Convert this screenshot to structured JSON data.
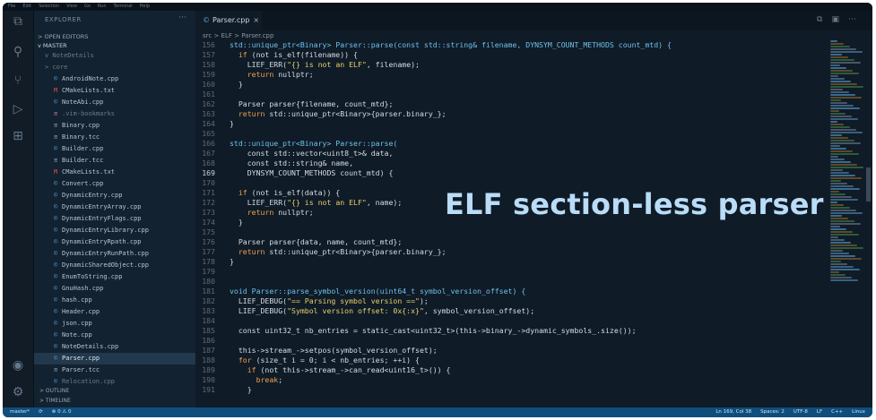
{
  "menubar": [
    "File",
    "Edit",
    "Selection",
    "View",
    "Go",
    "Run",
    "Terminal",
    "Help"
  ],
  "sidebar": {
    "title": "EXPLORER",
    "more": "···",
    "open_editors": "> OPEN EDITORS",
    "master": "v MASTER",
    "items": [
      {
        "label": "v NoteDetails",
        "icon": "folder",
        "dim": true
      },
      {
        "label": "> core",
        "icon": "folder",
        "dim": true
      },
      {
        "label": "AndroidNote.cpp",
        "icon": "cpp"
      },
      {
        "label": "CMakeLists.txt",
        "icon": "cmake"
      },
      {
        "label": "NoteAbi.cpp",
        "icon": "cpp"
      },
      {
        "label": ".vim-bookmarks",
        "icon": "txt",
        "dim": true
      },
      {
        "label": "Binary.cpp",
        "icon": "tcc"
      },
      {
        "label": "Binary.tcc",
        "icon": "tcc"
      },
      {
        "label": "Builder.cpp",
        "icon": "cpp"
      },
      {
        "label": "Builder.tcc",
        "icon": "tcc"
      },
      {
        "label": "CMakeLists.txt",
        "icon": "cmake"
      },
      {
        "label": "Convert.cpp",
        "icon": "cpp"
      },
      {
        "label": "DynamicEntry.cpp",
        "icon": "cpp"
      },
      {
        "label": "DynamicEntryArray.cpp",
        "icon": "cpp"
      },
      {
        "label": "DynamicEntryFlags.cpp",
        "icon": "cpp"
      },
      {
        "label": "DynamicEntryLibrary.cpp",
        "icon": "cpp"
      },
      {
        "label": "DynamicEntryRpath.cpp",
        "icon": "cpp"
      },
      {
        "label": "DynamicEntryRunPath.cpp",
        "icon": "cpp"
      },
      {
        "label": "DynamicSharedObject.cpp",
        "icon": "cpp"
      },
      {
        "label": "EnumToString.cpp",
        "icon": "cpp"
      },
      {
        "label": "GnuHash.cpp",
        "icon": "cpp"
      },
      {
        "label": "hash.cpp",
        "icon": "cpp"
      },
      {
        "label": "Header.cpp",
        "icon": "cpp"
      },
      {
        "label": "json.cpp",
        "icon": "cpp"
      },
      {
        "label": "Note.cpp",
        "icon": "cpp"
      },
      {
        "label": "NoteDetails.cpp",
        "icon": "cpp"
      },
      {
        "label": "Parser.cpp",
        "icon": "cpp",
        "active": true
      },
      {
        "label": "Parser.tcc",
        "icon": "tcc"
      },
      {
        "label": "Relocation.cpp",
        "icon": "cpp",
        "dim": true
      }
    ],
    "outline": "> OUTLINE",
    "timeline": "> TIMELINE"
  },
  "tab": {
    "label": "Parser.cpp",
    "close": "×"
  },
  "breadcrumb": "src > ELF > Parser.cpp",
  "code_lines": [
    {
      "n": "156",
      "segs": [
        [
          "t",
          "std::unique_ptr<Binary> Parser::parse(const std::string& filename, DYNSYM_COUNT_METHODS count_mtd) {"
        ]
      ]
    },
    {
      "n": "157",
      "segs": [
        [
          "txt",
          "  "
        ],
        [
          "k",
          "if"
        ],
        [
          "txt",
          " (not is_elf(filename)) {"
        ]
      ]
    },
    {
      "n": "158",
      "segs": [
        [
          "txt",
          "    LIEF_ERR("
        ],
        [
          "s",
          "\"{} is not an ELF\""
        ],
        [
          "txt",
          ", filename);"
        ]
      ]
    },
    {
      "n": "159",
      "segs": [
        [
          "txt",
          "    "
        ],
        [
          "k",
          "return"
        ],
        [
          "txt",
          " nullptr;"
        ]
      ]
    },
    {
      "n": "160",
      "segs": [
        [
          "txt",
          "  }"
        ]
      ]
    },
    {
      "n": "161",
      "segs": [
        [
          "txt",
          ""
        ]
      ]
    },
    {
      "n": "162",
      "segs": [
        [
          "txt",
          "  Parser parser{filename, count_mtd};"
        ]
      ]
    },
    {
      "n": "163",
      "segs": [
        [
          "txt",
          "  "
        ],
        [
          "k",
          "return"
        ],
        [
          "txt",
          " std::unique_ptr<Binary>{parser.binary_};"
        ]
      ]
    },
    {
      "n": "164",
      "segs": [
        [
          "txt",
          "}"
        ]
      ]
    },
    {
      "n": "165",
      "segs": [
        [
          "txt",
          ""
        ]
      ]
    },
    {
      "n": "166",
      "segs": [
        [
          "t",
          "std::unique_ptr<Binary> Parser::parse("
        ]
      ]
    },
    {
      "n": "167",
      "segs": [
        [
          "txt",
          "    const std::vector<uint8_t>& data,"
        ]
      ]
    },
    {
      "n": "168",
      "segs": [
        [
          "txt",
          "    const std::string& name,"
        ]
      ]
    },
    {
      "n": "169",
      "segs": [
        [
          "txt",
          "    DYNSYM_COUNT_METHODS count_mtd) {"
        ]
      ],
      "cur": true
    },
    {
      "n": "170",
      "segs": [
        [
          "txt",
          ""
        ]
      ]
    },
    {
      "n": "171",
      "segs": [
        [
          "txt",
          "  "
        ],
        [
          "k",
          "if"
        ],
        [
          "txt",
          " (not is_elf(data)) {"
        ]
      ]
    },
    {
      "n": "172",
      "segs": [
        [
          "txt",
          "    LIEF_ERR("
        ],
        [
          "s",
          "\"{} is not an ELF\""
        ],
        [
          "txt",
          ", name);"
        ]
      ]
    },
    {
      "n": "173",
      "segs": [
        [
          "txt",
          "    "
        ],
        [
          "k",
          "return"
        ],
        [
          "txt",
          " nullptr;"
        ]
      ]
    },
    {
      "n": "174",
      "segs": [
        [
          "txt",
          "  }"
        ]
      ]
    },
    {
      "n": "175",
      "segs": [
        [
          "txt",
          ""
        ]
      ]
    },
    {
      "n": "176",
      "segs": [
        [
          "txt",
          "  Parser parser{data, name, count_mtd};"
        ]
      ]
    },
    {
      "n": "177",
      "segs": [
        [
          "txt",
          "  "
        ],
        [
          "k",
          "return"
        ],
        [
          "txt",
          " std::unique_ptr<Binary>{parser.binary_};"
        ]
      ]
    },
    {
      "n": "178",
      "segs": [
        [
          "txt",
          "}"
        ]
      ]
    },
    {
      "n": "179",
      "segs": [
        [
          "txt",
          ""
        ]
      ]
    },
    {
      "n": "180",
      "segs": [
        [
          "txt",
          ""
        ]
      ]
    },
    {
      "n": "181",
      "segs": [
        [
          "t",
          "void Parser::parse_symbol_version(uint64_t symbol_version_offset) {"
        ]
      ]
    },
    {
      "n": "182",
      "segs": [
        [
          "txt",
          "  LIEF_DEBUG("
        ],
        [
          "s",
          "\"== Parsing symbol version ==\""
        ],
        [
          "txt",
          ");"
        ]
      ]
    },
    {
      "n": "183",
      "segs": [
        [
          "txt",
          "  LIEF_DEBUG("
        ],
        [
          "s",
          "\"Symbol version offset: 0x{:x}\""
        ],
        [
          "txt",
          ", symbol_version_offset);"
        ]
      ]
    },
    {
      "n": "184",
      "segs": [
        [
          "txt",
          ""
        ]
      ]
    },
    {
      "n": "185",
      "segs": [
        [
          "txt",
          "  const uint32_t nb_entries = static_cast<uint32_t>(this->binary_->dynamic_symbols_.size());"
        ]
      ]
    },
    {
      "n": "186",
      "segs": [
        [
          "txt",
          ""
        ]
      ]
    },
    {
      "n": "187",
      "segs": [
        [
          "txt",
          "  this->stream_->setpos(symbol_version_offset);"
        ]
      ]
    },
    {
      "n": "188",
      "segs": [
        [
          "txt",
          "  "
        ],
        [
          "k",
          "for"
        ],
        [
          "txt",
          " (size_t i = 0; i < nb_entries; ++i) {"
        ]
      ]
    },
    {
      "n": "189",
      "segs": [
        [
          "txt",
          "    "
        ],
        [
          "k",
          "if"
        ],
        [
          "txt",
          " (not this->stream_->can_read<uint16_t>()) {"
        ]
      ]
    },
    {
      "n": "190",
      "segs": [
        [
          "txt",
          "      "
        ],
        [
          "k",
          "break"
        ],
        [
          "txt",
          ";"
        ]
      ]
    },
    {
      "n": "191",
      "segs": [
        [
          "txt",
          "    }"
        ]
      ]
    }
  ],
  "overlay_title": "ELF section-less parser",
  "statusbar": {
    "left": [
      "master*",
      "⟳",
      "⊗ 0 ⚠ 0"
    ],
    "right": [
      "Ln 169, Col 38",
      "Spaces: 2",
      "UTF-8",
      "LF",
      "C++",
      "Linux"
    ]
  },
  "colors": {
    "accent": "#0f4e7c",
    "overlay": "#b9dcf7",
    "background": "#0f1b27"
  }
}
